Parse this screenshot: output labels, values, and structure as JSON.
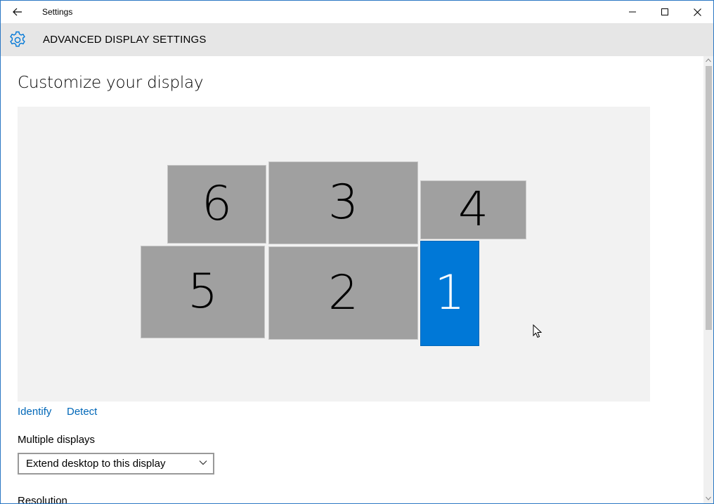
{
  "window": {
    "title": "Settings",
    "icons": {
      "back": "back-arrow-icon",
      "minimize": "minimize-icon",
      "maximize": "maximize-icon",
      "close": "close-icon"
    }
  },
  "header": {
    "title": "ADVANCED DISPLAY SETTINGS",
    "icon": "gear-icon",
    "accent_color": "#0078d7"
  },
  "main": {
    "page_title": "Customize your display",
    "monitors": [
      {
        "label": "6",
        "selected": false
      },
      {
        "label": "3",
        "selected": false
      },
      {
        "label": "4",
        "selected": false
      },
      {
        "label": "5",
        "selected": false
      },
      {
        "label": "2",
        "selected": false
      },
      {
        "label": "1",
        "selected": true
      }
    ],
    "links": {
      "identify": "Identify",
      "detect": "Detect"
    },
    "multiple_displays": {
      "label": "Multiple displays",
      "selected_value": "Extend desktop to this display"
    },
    "resolution_label": "Resolution"
  },
  "colors": {
    "monitor": "#a0a0a0",
    "monitor_selected": "#0078d7",
    "link": "#0067b8",
    "header_bg": "#e6e6e6"
  }
}
